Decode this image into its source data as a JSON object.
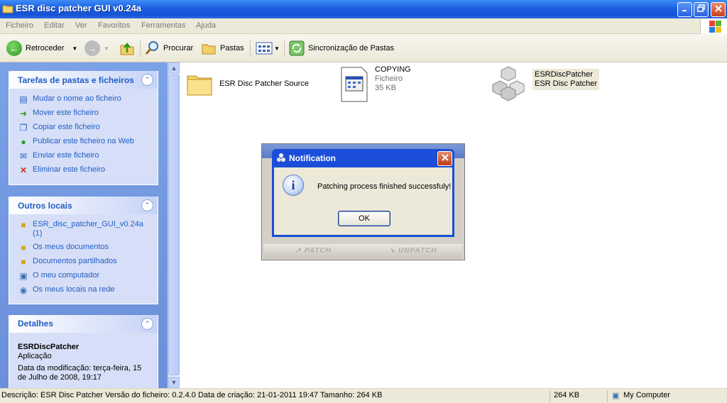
{
  "window": {
    "title": "ESR disc patcher GUI v0.24a"
  },
  "menu": [
    "Ficheiro",
    "Editar",
    "Ver",
    "Favoritos",
    "Ferramentas",
    "Ajuda"
  ],
  "toolbar": {
    "back": "Retroceder",
    "search": "Procurar",
    "folders": "Pastas",
    "sync": "Sincronização de Pastas"
  },
  "tasks_panel": {
    "title": "Tarefas de pastas e ficheiros",
    "items": [
      {
        "label": "Mudar o nome ao ficheiro",
        "icon": "rename-icon"
      },
      {
        "label": "Mover este ficheiro",
        "icon": "move-icon"
      },
      {
        "label": "Copiar este ficheiro",
        "icon": "copy-icon"
      },
      {
        "label": "Publicar este ficheiro na Web",
        "icon": "publish-web-icon"
      },
      {
        "label": "Enviar este ficheiro",
        "icon": "email-icon"
      },
      {
        "label": "Eliminar este ficheiro",
        "icon": "delete-icon"
      }
    ]
  },
  "places_panel": {
    "title": "Outros locais",
    "items": [
      {
        "label": "ESR_disc_patcher_GUI_v0.24a (1)",
        "icon": "folder-icon"
      },
      {
        "label": "Os meus documentos",
        "icon": "documents-icon"
      },
      {
        "label": "Documentos partilhados",
        "icon": "shared-folder-icon"
      },
      {
        "label": "O meu computador",
        "icon": "computer-icon"
      },
      {
        "label": "Os meus locais na rede",
        "icon": "network-icon"
      }
    ]
  },
  "details_panel": {
    "title": "Detalhes",
    "name": "ESRDiscPatcher",
    "type": "Aplicação",
    "modified": "Data da modificação: terça-feira, 15 de Julho de 2008, 19:17"
  },
  "files": [
    {
      "name": "ESR Disc Patcher Source",
      "icon": "folder-icon"
    },
    {
      "name": "COPYING",
      "type": "Ficheiro",
      "size": "35 KB",
      "icon": "text-file-icon"
    },
    {
      "name": "ESRDiscPatcher",
      "desc": "ESR Disc Patcher",
      "icon": "app-cubes-icon"
    }
  ],
  "patcher": {
    "patch": "PATCH",
    "unpatch": "UNPATCH"
  },
  "dialog": {
    "title": "Notification",
    "message": "Patching process finished successfuly!",
    "ok": "OK"
  },
  "status": {
    "description": "Descrição: ESR Disc Patcher Versão do ficheiro: 0.2.4.0 Data de criação: 21-01-2011 19:47 Tamanho: 264 KB",
    "size": "264 KB",
    "zone": "My Computer"
  }
}
